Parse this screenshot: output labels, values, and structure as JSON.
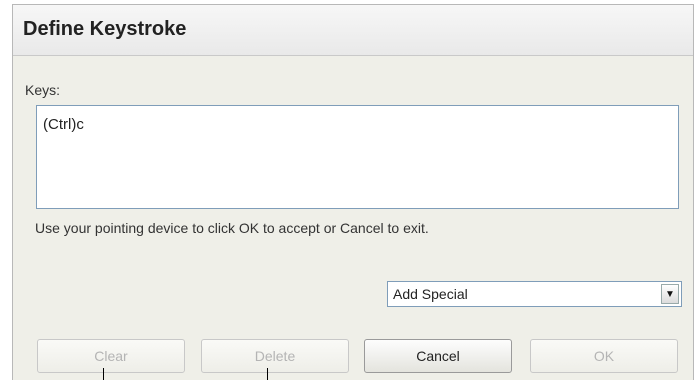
{
  "dialog": {
    "title": "Define Keystroke",
    "keys_label": "Keys:",
    "keys_value": "(Ctrl)c",
    "hint": "Use your pointing device to click OK to accept or Cancel to exit.",
    "add_special": {
      "selected": "Add Special"
    },
    "buttons": {
      "clear": "Clear",
      "delete": "Delete",
      "cancel": "Cancel",
      "ok": "OK"
    }
  }
}
